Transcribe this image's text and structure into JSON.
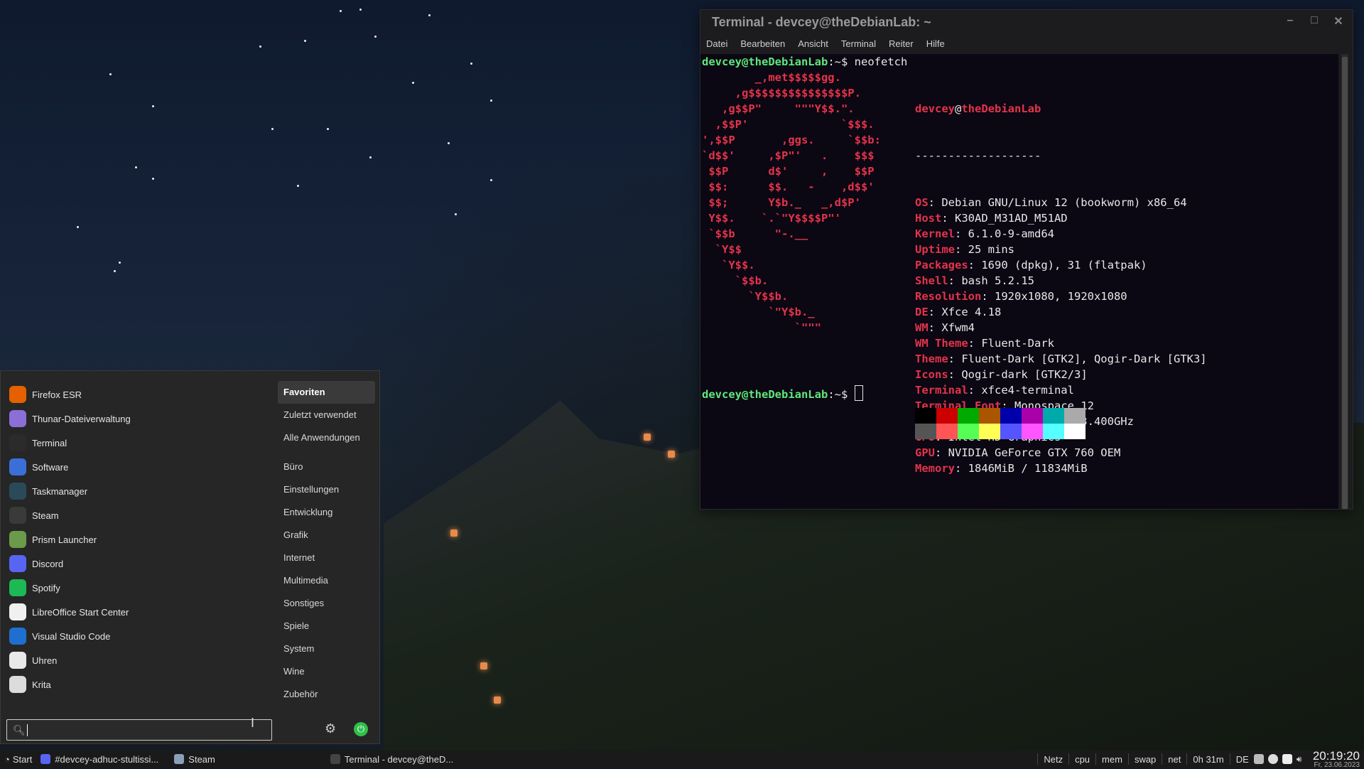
{
  "terminal": {
    "title": "Terminal - devcey@theDebianLab: ~",
    "window_buttons": [
      "–",
      "□",
      "✕"
    ],
    "menu": [
      "Datei",
      "Bearbeiten",
      "Ansicht",
      "Terminal",
      "Reiter",
      "Hilfe"
    ],
    "prompt_user": "devcey@theDebianLab",
    "prompt_path": ":~",
    "prompt_symbol": "$",
    "command": "neofetch",
    "logo": [
      "        _,met$$$$$gg.",
      "     ,g$$$$$$$$$$$$$$$P.",
      "   ,g$$P\"     \"\"\"Y$$.\".",
      "  ,$$P'              `$$$.",
      "',$$P       ,ggs.     `$$b:",
      "`d$$'     ,$P\"'   .    $$$",
      " $$P      d$'     ,    $$P",
      " $$:      $$.   -    ,d$$'",
      " $$;      Y$b._   _,d$P'",
      " Y$$.    `.`\"Y$$$$P\"'",
      " `$$b      \"-.__",
      "  `Y$$",
      "   `Y$$.",
      "     `$$b.",
      "       `Y$$b.",
      "          `\"Y$b._",
      "              `\"\"\""
    ],
    "info_user": "devcey",
    "info_at": "@",
    "info_host": "theDebianLab",
    "separator": "-------------------",
    "info": [
      {
        "key": "OS",
        "value": "Debian GNU/Linux 12 (bookworm) x86_64"
      },
      {
        "key": "Host",
        "value": "K30AD_M31AD_M51AD"
      },
      {
        "key": "Kernel",
        "value": "6.1.0-9-amd64"
      },
      {
        "key": "Uptime",
        "value": "25 mins"
      },
      {
        "key": "Packages",
        "value": "1690 (dpkg), 31 (flatpak)"
      },
      {
        "key": "Shell",
        "value": "bash 5.2.15"
      },
      {
        "key": "Resolution",
        "value": "1920x1080, 1920x1080"
      },
      {
        "key": "DE",
        "value": "Xfce 4.18"
      },
      {
        "key": "WM",
        "value": "Xfwm4"
      },
      {
        "key": "WM Theme",
        "value": "Fluent-Dark"
      },
      {
        "key": "Theme",
        "value": "Fluent-Dark [GTK2], Qogir-Dark [GTK3]"
      },
      {
        "key": "Icons",
        "value": "Qogir-dark [GTK2/3]"
      },
      {
        "key": "Terminal",
        "value": "xfce4-terminal"
      },
      {
        "key": "Terminal Font",
        "value": "Monospace 12"
      },
      {
        "key": "CPU",
        "value": "Intel i5-4460 (4) @ 3.400GHz"
      },
      {
        "key": "GPU",
        "value": "Intel HD Graphics"
      },
      {
        "key": "GPU",
        "value": "NVIDIA GeForce GTX 760 OEM"
      },
      {
        "key": "Memory",
        "value": "1846MiB / 11834MiB"
      }
    ],
    "palette": [
      "#000000",
      "#cc0000",
      "#00aa00",
      "#aa5500",
      "#0000aa",
      "#aa00aa",
      "#00aaaa",
      "#aaaaaa",
      "#555555",
      "#ff5555",
      "#55ff55",
      "#ffff55",
      "#5555ff",
      "#ff55ff",
      "#55ffff",
      "#ffffff"
    ]
  },
  "menu": {
    "apps": [
      {
        "label": "Firefox ESR",
        "icon": "firefox-icon",
        "color": "#e66000"
      },
      {
        "label": "Thunar-Dateiverwaltung",
        "icon": "folder-icon",
        "color": "#8b6fd6"
      },
      {
        "label": "Terminal",
        "icon": "terminal-icon",
        "color": "#2b2b2b"
      },
      {
        "label": "Software",
        "icon": "software-icon",
        "color": "#3b6fd8"
      },
      {
        "label": "Taskmanager",
        "icon": "taskmanager-icon",
        "color": "#2a4a5a"
      },
      {
        "label": "Steam",
        "icon": "steam-icon",
        "color": "#3a3a3a"
      },
      {
        "label": "Prism Launcher",
        "icon": "prism-icon",
        "color": "#6a9a4a"
      },
      {
        "label": "Discord",
        "icon": "discord-icon",
        "color": "#5865f2"
      },
      {
        "label": "Spotify",
        "icon": "spotify-icon",
        "color": "#1db954"
      },
      {
        "label": "LibreOffice Start Center",
        "icon": "libreoffice-icon",
        "color": "#f0f0f0"
      },
      {
        "label": "Visual Studio Code",
        "icon": "vscode-icon",
        "color": "#1f6fd0"
      },
      {
        "label": "Uhren",
        "icon": "clock-icon",
        "color": "#e8e8e8"
      },
      {
        "label": "Krita",
        "icon": "krita-icon",
        "color": "#dcdcdc"
      }
    ],
    "categories_top": [
      "Favoriten",
      "Zuletzt verwendet",
      "Alle Anwendungen"
    ],
    "categories": [
      "Büro",
      "Einstellungen",
      "Entwicklung",
      "Grafik",
      "Internet",
      "Multimedia",
      "Sonstiges",
      "Spiele",
      "System",
      "Wine",
      "Zubehör"
    ],
    "selected_category": "Favoriten",
    "search_value": "",
    "search_placeholder": ""
  },
  "taskbar": {
    "start_label": "Start",
    "tasks": [
      {
        "label": "#devcey-adhuc-stultissi...",
        "icon": "discord-icon",
        "color": "#5865f2"
      },
      {
        "label": "Steam",
        "icon": "steam-icon",
        "color": "#8aa0b8"
      },
      {
        "label": "Terminal - devcey@theD...",
        "icon": "terminal-icon",
        "color": "#444444"
      }
    ],
    "monitors": [
      "Netz",
      "cpu",
      "mem",
      "swap",
      "net"
    ],
    "uptime": "0h 31m",
    "keyboard_layout": "DE",
    "time": "20:19:20",
    "date": "Fr, 23.06.2023"
  }
}
